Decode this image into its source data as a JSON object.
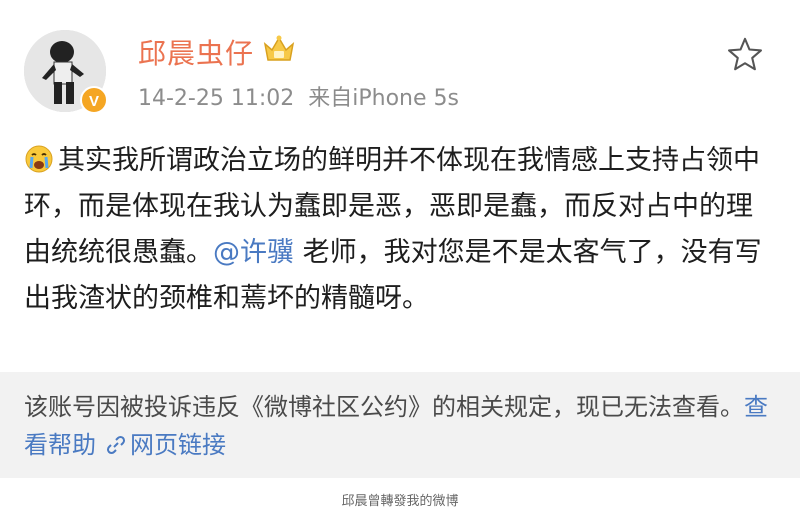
{
  "post": {
    "username": "邱晨虫仔",
    "timestamp": "14-2-25 11:02",
    "source": "来自iPhone 5s",
    "verified_badge": "V",
    "text_part1": "其实我所谓政治立场的鲜明并不体现在我情感上支持占领中环，而是体现在我认为蠢即是恶，恶即是蠢，而反对占中的理由统统很愚蠢。",
    "mention": "@许骥",
    "text_part2": " 老师，我对您是不是太客气了，没有写出我渣状的颈椎和蔫坏的精髓呀。",
    "emoji": "crying-face-icon"
  },
  "notice": {
    "text": "该账号因被投诉违反《微博社区公约》的相关规定，现已无法查看。",
    "help_label": "查看帮助",
    "link_label": "网页链接"
  },
  "caption": "邱晨曾轉發我的微博",
  "colors": {
    "username": "#eb7350",
    "link": "#4a7ac2",
    "notice_bg": "#f2f2f2"
  }
}
